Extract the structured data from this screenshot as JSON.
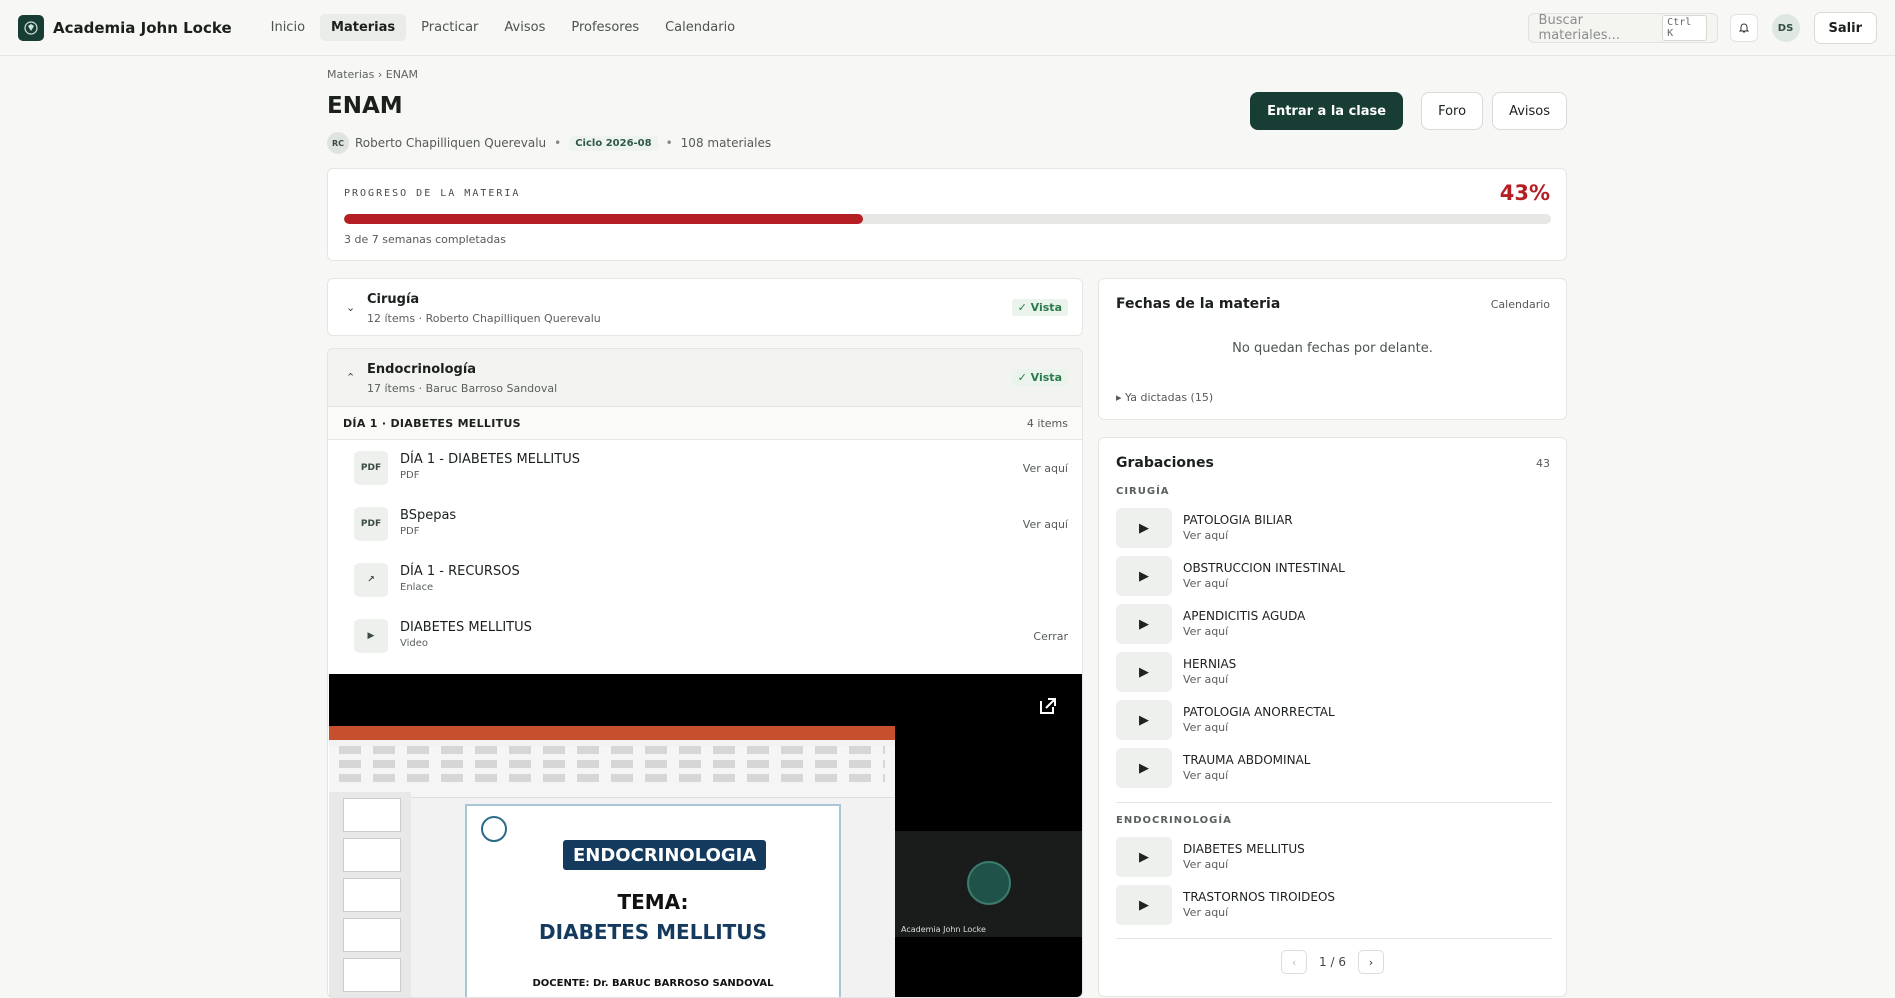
{
  "app": {
    "brand": "Academia John Locke"
  },
  "nav": {
    "items": [
      {
        "label": "Inicio",
        "active": false
      },
      {
        "label": "Materias",
        "active": true
      },
      {
        "label": "Practicar",
        "active": false
      },
      {
        "label": "Avisos",
        "active": false
      },
      {
        "label": "Profesores",
        "active": false
      },
      {
        "label": "Calendario",
        "active": false
      }
    ],
    "search_placeholder": "Buscar materiales...",
    "search_shortcut": "Ctrl K",
    "user_initials": "DS",
    "logout_label": "Salir"
  },
  "header": {
    "breadcrumb": "Materias › ENAM",
    "title": "ENAM",
    "teacher_initials": "RC",
    "teacher": "Roberto Chapilliquen Querevalu",
    "cycle": "Ciclo 2026-08",
    "materials": "108 materiales",
    "actions": {
      "enter": "Entrar a la clase",
      "forum": "Foro",
      "notices": "Avisos"
    }
  },
  "progress": {
    "label": "PROGRESO DE LA MATERIA",
    "percent_text": "43%",
    "percent": 43,
    "subtitle": "3 de 7 semanas completadas",
    "color": "#b51f24"
  },
  "modules": [
    {
      "title": "Cirugía",
      "subtitle": "12 ítems · Roberto Chapilliquen Querevalu",
      "badge": "✓ Vista",
      "expanded": false
    },
    {
      "title": "Endocrinología",
      "subtitle": "17 ítems · Baruc Barroso Sandoval",
      "badge": "✓ Vista",
      "expanded": true
    }
  ],
  "day": {
    "title": "DÍA 1 · DIABETES MELLITUS",
    "count": "4 items"
  },
  "items": [
    {
      "icon": "PDF",
      "title": "DÍA 1 - DIABETES MELLITUS",
      "type": "PDF",
      "action": "Ver aquí"
    },
    {
      "icon": "PDF",
      "title": "BSpepas",
      "type": "PDF",
      "action": "Ver aquí"
    },
    {
      "icon": "↗",
      "title": "DÍA 1 - RECURSOS",
      "type": "Enlace",
      "action": ""
    },
    {
      "icon": "▶",
      "title": "DIABETES MELLITUS",
      "type": "Video",
      "action": "Cerrar"
    }
  ],
  "video": {
    "slide_band": "ENDOCRINOLOGIA",
    "slide_tema": "TEMA:",
    "slide_topic": "DIABETES MELLITUS",
    "slide_teacher": "DOCENTE: Dr. BARUC BARROSO SANDOVAL",
    "camera_name": "Academia John Locke"
  },
  "fechas": {
    "title": "Fechas de la materia",
    "link": "Calendario",
    "empty": "No quedan fechas por delante.",
    "past": "▸ Ya dictadas (15)"
  },
  "grabaciones": {
    "title": "Grabaciones",
    "count": "43",
    "groups": [
      {
        "label": "CIRUGÍA",
        "items": [
          {
            "title": "PATOLOGIA BILIAR",
            "sub": "Ver aquí"
          },
          {
            "title": "OBSTRUCCION INTESTINAL",
            "sub": "Ver aquí"
          },
          {
            "title": "APENDICITIS AGUDA",
            "sub": "Ver aquí"
          },
          {
            "title": "HERNIAS",
            "sub": "Ver aquí"
          },
          {
            "title": "PATOLOGIA ANORRECTAL",
            "sub": "Ver aquí"
          },
          {
            "title": "TRAUMA ABDOMINAL",
            "sub": "Ver aquí"
          }
        ]
      },
      {
        "label": "ENDOCRINOLOGÍA",
        "items": [
          {
            "title": "DIABETES MELLITUS",
            "sub": "Ver aquí"
          },
          {
            "title": "TRASTORNOS TIROIDEOS",
            "sub": "Ver aquí"
          }
        ]
      }
    ],
    "pager": {
      "prev": "‹",
      "text": "1 / 6",
      "next": "›"
    }
  }
}
